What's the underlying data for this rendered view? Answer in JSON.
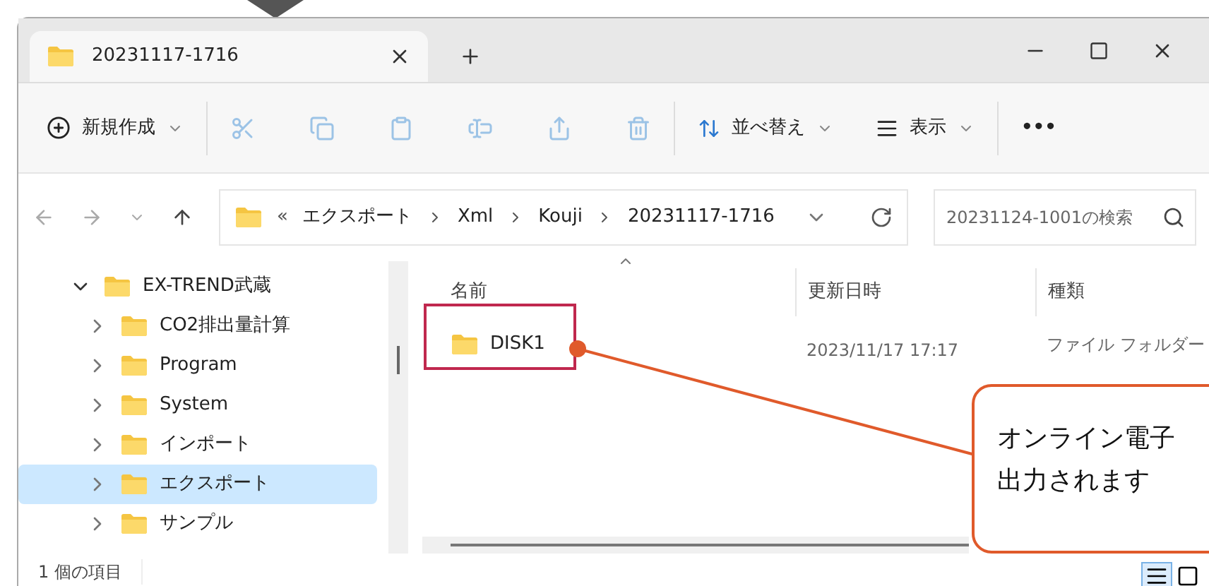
{
  "tab": {
    "title": "20231117-1716"
  },
  "toolbar": {
    "new": "新規作成",
    "sort": "並べ替え",
    "view": "表示",
    "more": "•••"
  },
  "address": {
    "overflow": "«",
    "crumbs": [
      "エクスポート",
      "Xml",
      "Kouji",
      "20231117-1716"
    ]
  },
  "search": {
    "placeholder": "20231124-1001の検索"
  },
  "tree": [
    {
      "label": "EX-TREND武蔵",
      "expanded": true,
      "selected": false,
      "children": [
        {
          "label": "CO2排出量計算",
          "expanded": false,
          "selected": false
        },
        {
          "label": "Program",
          "expanded": false,
          "selected": false
        },
        {
          "label": "System",
          "expanded": false,
          "selected": false
        },
        {
          "label": "インポート",
          "expanded": false,
          "selected": false
        },
        {
          "label": "エクスポート",
          "expanded": false,
          "selected": true
        },
        {
          "label": "サンプル",
          "expanded": false,
          "selected": false
        }
      ]
    }
  ],
  "columns": [
    "名前",
    "更新日時",
    "種類"
  ],
  "rows": [
    {
      "name": "DISK1",
      "modified": "2023/11/17 17:17",
      "type": "ファイル フォルダー"
    }
  ],
  "status_bar": {
    "count": "1 個の項目",
    "views": [
      {
        "kind": "details",
        "selected": true
      },
      {
        "kind": "tiles",
        "selected": false
      }
    ]
  },
  "callout": {
    "lines": [
      "オンライン電子",
      "出力されます"
    ]
  }
}
